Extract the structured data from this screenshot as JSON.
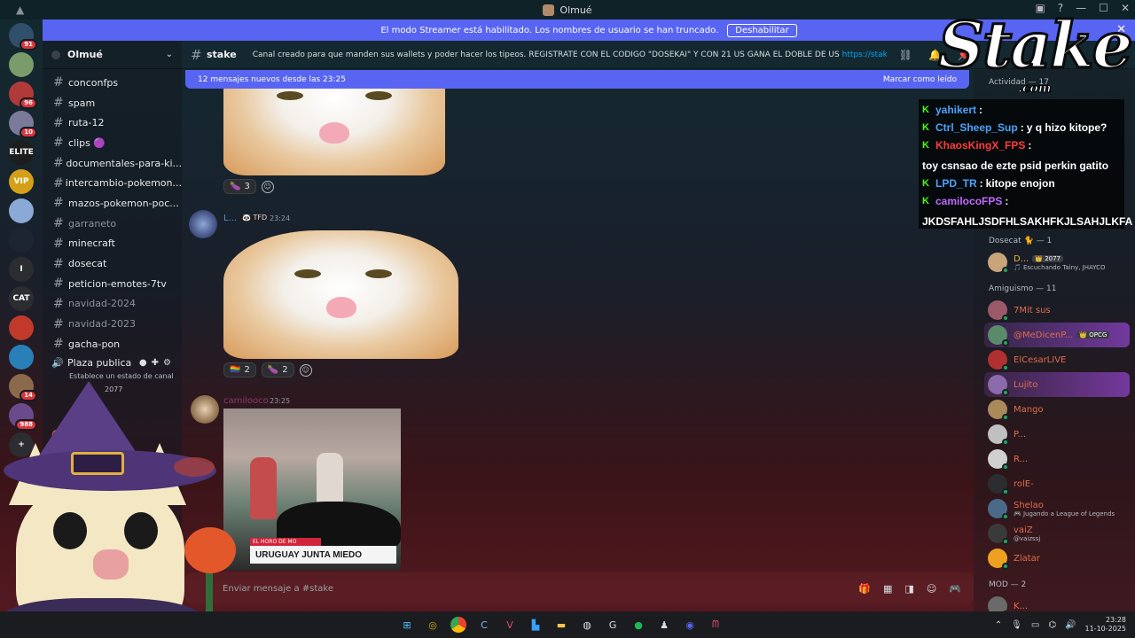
{
  "window": {
    "title": "Olmué"
  },
  "banner": {
    "text": "El modo Streamer está habilitado. Los nombres de usuario se han truncado.",
    "button": "Deshabilitar",
    "close": "✕"
  },
  "servers": [
    {
      "label": "",
      "color": "#2f4f6b",
      "badge": "91"
    },
    {
      "label": "",
      "color": "#7a9b6a",
      "badge": ""
    },
    {
      "label": "",
      "color": "#b03a3a",
      "badge": "96"
    },
    {
      "label": "",
      "color": "#7a7a9a",
      "badge": "10"
    },
    {
      "label": "ELITE",
      "color": "#1d1d1d",
      "badge": ""
    },
    {
      "label": "VIP",
      "color": "#d4a017",
      "badge": ""
    },
    {
      "label": "",
      "color": "#8aa9d6",
      "badge": ""
    },
    {
      "label": "",
      "color": "#1d2530",
      "badge": ""
    },
    {
      "label": "I",
      "color": "#2b2d31",
      "badge": ""
    },
    {
      "label": "CAT",
      "color": "#2b2d31",
      "badge": ""
    },
    {
      "label": "",
      "color": "#c0392b",
      "badge": ""
    },
    {
      "label": "",
      "color": "#2980b9",
      "badge": ""
    },
    {
      "label": "",
      "color": "#8a6a4a",
      "badge": "14"
    },
    {
      "label": "",
      "color": "#6a4a8a",
      "badge": "988"
    },
    {
      "label": "+",
      "color": "#2b2d31",
      "badge": ""
    }
  ],
  "guild": {
    "name": "Olmué"
  },
  "channels": [
    {
      "name": "conconfps",
      "muted": false
    },
    {
      "name": "spam",
      "muted": false
    },
    {
      "name": "ruta-12",
      "muted": false
    },
    {
      "name": "clips 🟣",
      "muted": false
    },
    {
      "name": "documentales-para-ki...",
      "muted": false
    },
    {
      "name": "intercambio-pokemon...",
      "muted": false
    },
    {
      "name": "mazos-pokemon-poc...",
      "muted": false
    },
    {
      "name": "garraneto",
      "muted": true
    },
    {
      "name": "minecraft",
      "muted": false
    },
    {
      "name": "dosecat",
      "muted": false
    },
    {
      "name": "peticion-emotes-7tv",
      "muted": false
    },
    {
      "name": "navidad-2024",
      "muted": true
    },
    {
      "name": "navidad-2023",
      "muted": true
    },
    {
      "name": "gacha-pon",
      "muted": false
    }
  ],
  "voice": {
    "name": "Plaza publica",
    "status": "Establece un estado de canal",
    "partial_user": "2077"
  },
  "chat": {
    "channel": "stake",
    "topic": "Canal creado para que manden sus wallets y poder hacer los tipeos. REGISTRATE CON EL CODIGO \"DOSEKAI\" Y CON 21 US GANA EL DOBLE DE US",
    "topic_link": "https://stake.com/?offer=do...",
    "new_messages": "12 mensajes nuevos desde las 23:25",
    "mark_read": "Marcar como leído",
    "composer_placeholder": "Enviar mensaje a #stake"
  },
  "messages": [
    {
      "reactions": [
        {
          "emoji": "🍆",
          "count": "3"
        }
      ]
    },
    {
      "author": "L...",
      "tag": "🐼 TFD",
      "time": "23:24",
      "reactions": [
        {
          "emoji": "🏳️‍🌈",
          "count": "2"
        },
        {
          "emoji": "🍆",
          "count": "2"
        }
      ]
    },
    {
      "author": "camilooco",
      "time": "23:25",
      "clip_caption": "URUGUAY JUNTA MIEDO",
      "clip_small": "EL HORO DE MO"
    }
  ],
  "members": {
    "activity_header": "Actividad — 17",
    "groups": [
      {
        "title": "Dosecat 🐈 — 1"
      },
      {
        "title": "Amiguismo — 11"
      },
      {
        "title": "MOD — 2"
      }
    ],
    "dosecat": [
      {
        "name": "D...",
        "tag": "👑 2077",
        "sub": "🎵 Escuchando Tainy, JHAYCO",
        "color": "#f0b232",
        "av": "#c8a47a"
      }
    ],
    "amiguismo": [
      {
        "name": "7Mit sus",
        "sub": "",
        "tag": "",
        "color": "#e06c4c",
        "av": "#9a5a6a"
      },
      {
        "name": "@MeDicenP...",
        "sub": "",
        "tag": "👑 OPCG",
        "color": "#e06c4c",
        "av": "#5a8a6a",
        "hl": true
      },
      {
        "name": "ElCesarLIVE",
        "sub": "",
        "tag": "",
        "color": "#e06c4c",
        "av": "#b03030"
      },
      {
        "name": "Lujito",
        "sub": "",
        "tag": "",
        "color": "#e06c4c",
        "av": "#8a6aaa",
        "hl": true
      },
      {
        "name": "Mango",
        "sub": "",
        "tag": "",
        "color": "#e06c4c",
        "av": "#aa8a5a"
      },
      {
        "name": "P...",
        "sub": "",
        "tag": "",
        "color": "#e06c4c",
        "av": "#c0c0c0"
      },
      {
        "name": "R...",
        "sub": "",
        "tag": "",
        "color": "#e06c4c",
        "av": "#d0d0d0"
      },
      {
        "name": "rolE-",
        "sub": "",
        "tag": "",
        "color": "#e06c4c",
        "av": "#2b2d31"
      },
      {
        "name": "Shelao",
        "sub": "🎮 Jugando a League of Legends",
        "tag": "",
        "color": "#e06c4c",
        "av": "#4a6a8a"
      },
      {
        "name": "vaiZ",
        "sub": "@vaizssj",
        "tag": "",
        "color": "#e06c4c",
        "av": "#3a3a3a"
      },
      {
        "name": "Zlatar",
        "sub": "",
        "tag": "",
        "color": "#e06c4c",
        "av": "#f0a020"
      }
    ],
    "mod": [
      {
        "name": "K...",
        "color": "#e06c4c",
        "av": "#6a6a6a"
      }
    ]
  },
  "overlay_chat": [
    {
      "user": "yahikert",
      "msg": "",
      "cls": "u1"
    },
    {
      "user": "Ctrl_Sheep_Sup",
      "msg": "y q hizo kitope?",
      "cls": "u2"
    },
    {
      "user": "KhaosKingX_FPS",
      "msg": "toy csnsao de ezte psid perkin gatito",
      "cls": "u3"
    },
    {
      "user": "LPD_TR",
      "msg": "kitope enojon",
      "cls": "u4"
    },
    {
      "user": "camilocoFPS",
      "msg": "JKDSFAHLJSDFHLSAKHFKJLSAHJLKFA",
      "cls": "u5"
    }
  ],
  "stake_logo": {
    "big": "Stake",
    "com": ".com"
  },
  "taskbar": {
    "time": "23:28",
    "date": "11-10-2025"
  },
  "colors": {
    "accent": "#5865f2",
    "kick_green": "#53fc18"
  }
}
